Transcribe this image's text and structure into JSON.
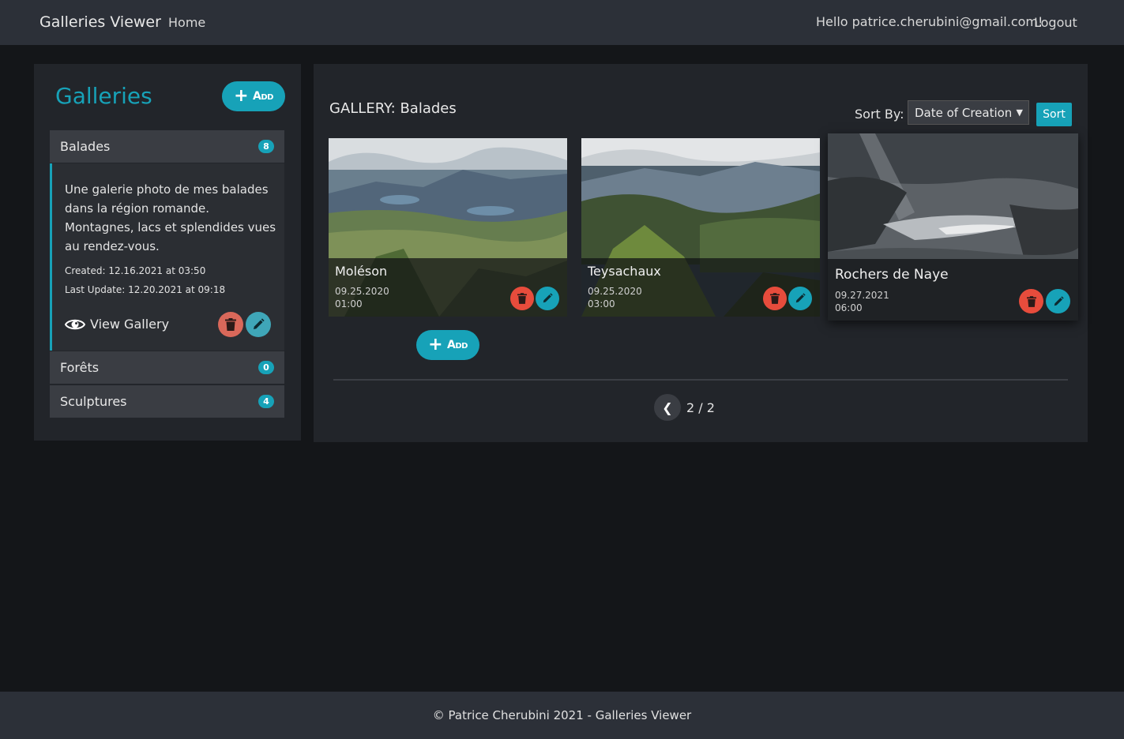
{
  "navbar": {
    "brand": "Galleries Viewer",
    "home": "Home",
    "greeting": "Hello patrice.cherubini@gmail.com!",
    "logout": "Logout"
  },
  "sidebar": {
    "title": "Galleries",
    "add_label": "Add",
    "galleries": [
      {
        "name": "Balades",
        "count": "8"
      },
      {
        "name": "Forêts",
        "count": "0"
      },
      {
        "name": "Sculptures",
        "count": "4"
      }
    ],
    "selected": {
      "description": "Une galerie photo de mes balades dans la région romande. Montagnes, lacs et splendides vues au rendez-vous.",
      "created": "Created: 12.16.2021 at 03:50",
      "updated": "Last Update: 12.20.2021 at 09:18",
      "view_label": "View Gallery"
    }
  },
  "main": {
    "title": "GALLERY: Balades",
    "sort_label": "Sort By:",
    "sort_selected": "Date of Creation",
    "sort_button": "Sort",
    "add_label": "Add",
    "pictures": [
      {
        "title": "Moléson",
        "date": "09.25.2020",
        "time": "01:00"
      },
      {
        "title": "Teysachaux",
        "date": "09.25.2020",
        "time": "03:00"
      },
      {
        "title": "Rochers de Naye",
        "date": "09.27.2021",
        "time": "06:00"
      }
    ],
    "pagination": "2 / 2"
  },
  "footer": {
    "text": "© Patrice Cherubini 2021 - Galleries Viewer"
  },
  "colors": {
    "accent": "#17a2b8",
    "danger": "#e74c3c",
    "background": "#141619",
    "panel": "#22252a",
    "navbar": "#2c3038"
  }
}
